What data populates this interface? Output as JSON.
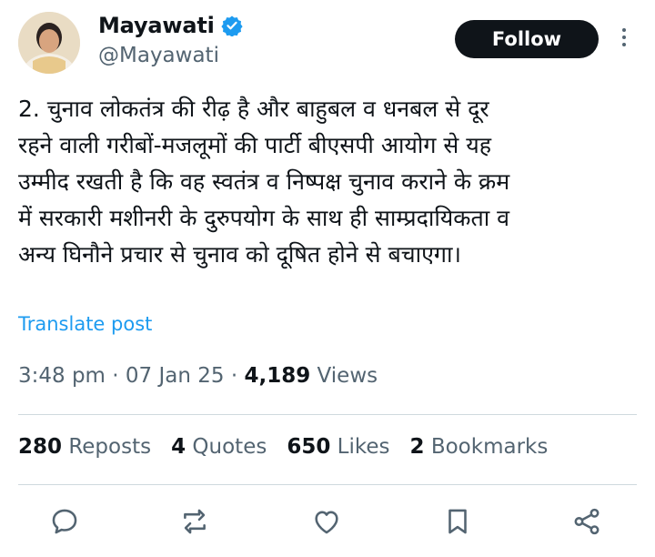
{
  "author": {
    "display_name": "Mayawati",
    "handle": "@Mayawati",
    "verified": true,
    "verified_color": "#1d9bf0"
  },
  "follow_label": "Follow",
  "post": {
    "text": "2. चुनाव लोकतंत्र की रीढ़ है और बाहुबल व धनबल से दूर\nरहने वाली गरीबों-मजलूमों की पार्टी बीएसपी आयोग से यह\nउम्मीद रखती है कि वह स्वतंत्र व निष्पक्ष चुनाव कराने के क्रम\nमें सरकारी मशीनरी के दुरुपयोग के साथ ही साम्प्रदायिकता व\nअन्य घिनौने प्रचार से चुनाव को दूषित होने से बचाएगा।",
    "translate_label": "Translate post"
  },
  "meta": {
    "time": "3:48 pm",
    "separator": " · ",
    "date": "07 Jan 25",
    "views_count": "4,189",
    "views_label": " Views"
  },
  "stats": {
    "reposts_count": "280",
    "reposts_label": " Reposts",
    "quotes_count": "4",
    "quotes_label": " Quotes",
    "likes_count": "650",
    "likes_label": " Likes",
    "bookmarks_count": "2",
    "bookmarks_label": " Bookmarks"
  },
  "actions": [
    "reply-icon",
    "repost-icon",
    "like-icon",
    "bookmark-icon",
    "share-icon"
  ],
  "colors": {
    "text": "#0f1419",
    "secondary": "#536471",
    "link": "#1d9bf0",
    "divider": "#cfd9de",
    "button_bg": "#0f1419"
  }
}
